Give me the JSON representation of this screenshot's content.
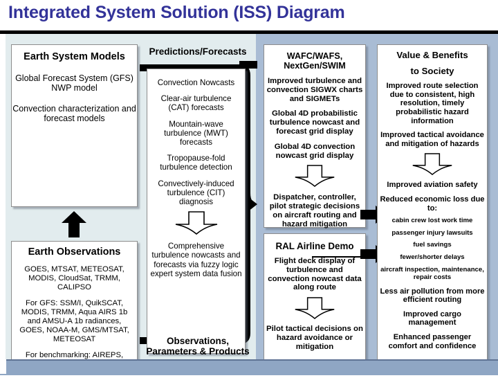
{
  "title": "Integrated System Solution (ISS) Diagram",
  "title_color": "#333399",
  "palette": {
    "left_panel_bg": "#e2ecee",
    "right_panel_bg": "#a9bcd4",
    "footer_bg": "#8fa6c4",
    "box_bg": "#ffffff",
    "box_border": "#8c8c8c",
    "arrow_fill": "#000000"
  },
  "columns": {
    "earth_system_models": {
      "heading": "Earth System Models",
      "lines": [
        "Global Forecast System (GFS) NWP model",
        "Convection characterization and forecast models"
      ]
    },
    "earth_observations": {
      "heading": "Earth Observations",
      "lines": [
        "GOES, MTSAT, METEOSAT, MODIS, CloudSat, TRMM, CALIPSO",
        "For GFS: SSM/I, QuikSCAT, MODIS, TRMM, Aqua AIRS 1b and  AMSU-A 1b radiances, GOES, NOAA-M, GMS/MTSAT, METEOSAT",
        "For benchmarking: AIREPS, AMDAR, EDR, TAMDAR turbulence"
      ]
    },
    "predictions_forecasts": {
      "heading": "Predictions/Forecasts",
      "footer": "Observations,\nParameters & Products",
      "footer_line1": "Observations,",
      "footer_line2": "Parameters & Products",
      "lines": [
        "Convection Nowcasts",
        "Clear-air turbulence (CAT) forecasts",
        "Mountain-wave turbulence (MWT) forecasts",
        "Tropopause-fold turbulence detection",
        "Convectively-induced turbulence (CIT) diagnosis"
      ],
      "after_arrow": "Comprehensive turbulence nowcasts and forecasts via fuzzy logic expert system data fusion",
      "after_arrow_bold_word": "turbulence",
      "arrow_icon": "down-arrow-icon"
    },
    "wafc_wafs": {
      "heading": "WAFC/WAFS,\nNextGen/SWIM",
      "heading_line1": "WAFC/WAFS,",
      "heading_line2": "NextGen/SWIM",
      "lines": [
        "Improved turbulence and convection SIGWX charts and SIGMETs",
        "Global 4D probabilistic turbulence nowcast and forecast grid display",
        "Global 4D convection nowcast grid display"
      ],
      "after_arrow": "Dispatcher, controller, pilot strategic decisions on aircraft routing and hazard mitigation",
      "arrow_icon": "down-arrow-icon"
    },
    "ral_airline_demo": {
      "heading": "RAL Airline Demo",
      "lines": [
        "Flight deck display of turbulence and convection nowcast data along route"
      ],
      "after_arrow": "Pilot tactical decisions on hazard avoidance or mitigation",
      "arrow_icon": "down-arrow-icon"
    },
    "value_benefits": {
      "heading": "Value & Benefits\nto Society",
      "heading_line1": "Value & Benefits",
      "heading_line2": "to Society",
      "lines": [
        "Improved route selection due to consistent, high resolution, timely probabilistic hazard information",
        "Improved tactical avoidance and mitigation of hazards"
      ],
      "arrow_icon": "down-arrow-icon",
      "after_arrow": [
        "Improved aviation safety",
        "Reduced economic loss due to:"
      ],
      "economic_items": [
        "cabin crew lost work time",
        "passenger injury lawsuits",
        "fuel savings",
        "fewer/shorter delays",
        "aircraft inspection, maintenance, repair costs"
      ],
      "tail": [
        "Less air pollution from more efficient routing",
        "Improved cargo management",
        "Enhanced passenger comfort and confidence"
      ]
    }
  },
  "connectors": {
    "up_arrow_icon": "up-block-arrow-icon",
    "bracket_icon": "bracket-connector-icon",
    "right_arrow_1_icon": "right-block-arrow-icon",
    "right_arrow_2_icon": "right-block-arrow-icon"
  }
}
